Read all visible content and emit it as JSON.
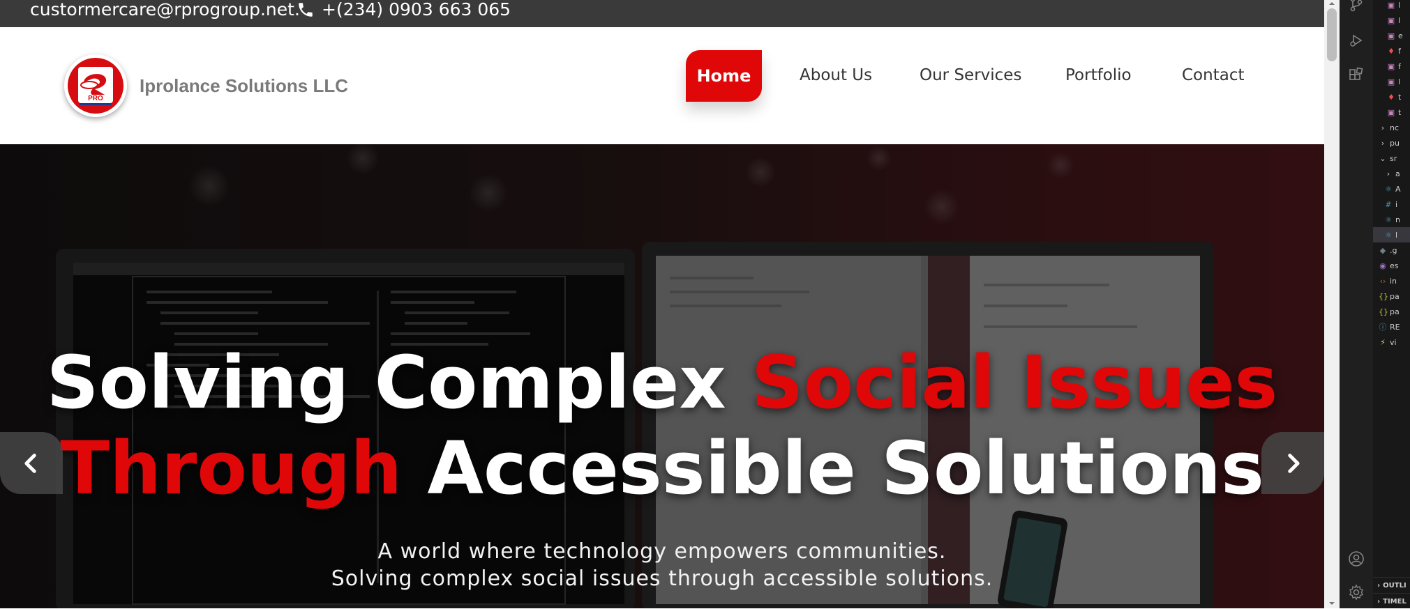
{
  "topbar": {
    "email": "custormercare@rprogroup.net.",
    "phone": "+(234) 0903 663 065"
  },
  "navbar": {
    "brand": "Iprolance Solutions LLC",
    "logo_text": "PRO",
    "items": [
      {
        "label": "Home",
        "active": true
      },
      {
        "label": "About Us"
      },
      {
        "label": "Our Services"
      },
      {
        "label": "Portfolio"
      },
      {
        "label": "Contact"
      }
    ]
  },
  "hero": {
    "line1_white": "Solving Complex",
    "line1_red": "Social Issues",
    "line2_red": "Through",
    "line2_white": "Accessible Solutions",
    "sub1": "A world where technology empowers communities.",
    "sub2": "Solving complex social issues through accessible solutions."
  },
  "colors": {
    "accent": "#e00709",
    "topbar_bg": "#3a3a3a",
    "brand_text": "#7a7a7a"
  },
  "editor": {
    "tree": [
      {
        "icon": "image-file-icon",
        "label": "l",
        "color": "#c586c0"
      },
      {
        "icon": "image-file-icon",
        "label": "l",
        "color": "#c586c0"
      },
      {
        "icon": "image-file-icon",
        "label": "e",
        "color": "#c586c0"
      },
      {
        "icon": "pdf-file-icon",
        "label": "f",
        "color": "#f14c4c"
      },
      {
        "icon": "image-file-icon",
        "label": "f",
        "color": "#c586c0"
      },
      {
        "icon": "image-file-icon",
        "label": "l",
        "color": "#c586c0"
      },
      {
        "icon": "pdf-file-icon",
        "label": "t",
        "color": "#f14c4c"
      },
      {
        "icon": "image-file-icon",
        "label": "t",
        "color": "#c586c0"
      },
      {
        "icon": "chevron-right-icon",
        "label": "nc",
        "color": "#cccccc"
      },
      {
        "icon": "chevron-right-icon",
        "label": "pu",
        "color": "#cccccc"
      },
      {
        "icon": "chevron-down-icon",
        "label": "sr",
        "color": "#cccccc"
      },
      {
        "icon": "chevron-right-icon",
        "label": "a",
        "color": "#cccccc"
      },
      {
        "icon": "react-file-icon",
        "label": "A",
        "color": "#519aba"
      },
      {
        "icon": "css-file-icon",
        "label": "i",
        "color": "#519aba"
      },
      {
        "icon": "react-file-icon",
        "label": "n",
        "color": "#519aba"
      },
      {
        "icon": "react-file-icon",
        "label": "l",
        "color": "#519aba"
      },
      {
        "icon": "gitignore-file-icon",
        "label": ".g",
        "color": "#6d8086"
      },
      {
        "icon": "eslint-file-icon",
        "label": "es",
        "color": "#a074c4"
      },
      {
        "icon": "html-file-icon",
        "label": "in",
        "color": "#e44d26"
      },
      {
        "icon": "json-file-icon",
        "label": "pa",
        "color": "#cbcb41"
      },
      {
        "icon": "json-file-icon",
        "label": "pa",
        "color": "#cbcb41"
      },
      {
        "icon": "info-file-icon",
        "label": "RE",
        "color": "#519aba"
      },
      {
        "icon": "vite-file-icon",
        "label": "vi",
        "color": "#ffcb2b"
      }
    ],
    "panels": [
      {
        "label": "OUTLI"
      },
      {
        "label": "TIMEL"
      }
    ]
  }
}
